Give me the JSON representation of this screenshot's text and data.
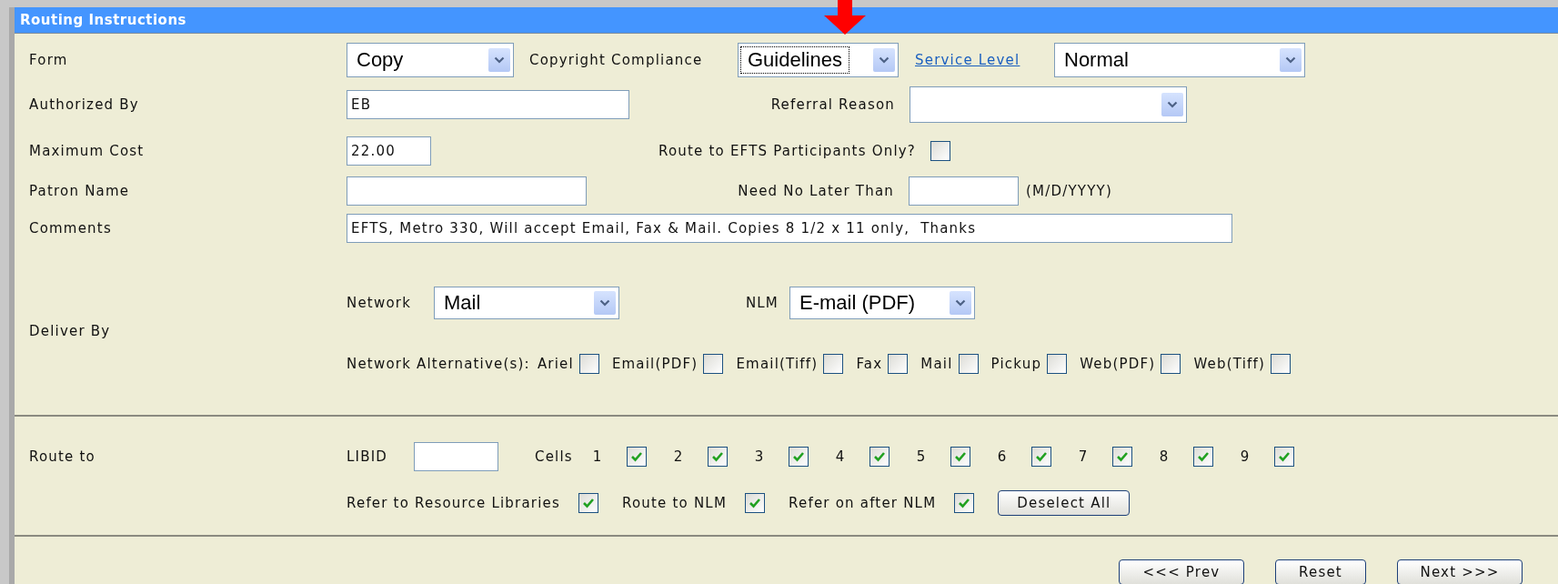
{
  "panel": {
    "title": "Routing Instructions"
  },
  "form": {
    "label": "Form",
    "value": "Copy"
  },
  "copyright_compliance": {
    "label": "Copyright Compliance",
    "value": "Guidelines",
    "focused": true
  },
  "service_level": {
    "label": "Service Level",
    "value": "Normal"
  },
  "authorized_by": {
    "label": "Authorized By",
    "value": "EB"
  },
  "referral_reason": {
    "label": "Referral Reason"
  },
  "maximum_cost": {
    "label": "Maximum Cost",
    "value": "22.00"
  },
  "route_to_efts": {
    "label": "Route to EFTS Participants Only?",
    "checked": false
  },
  "patron_name": {
    "label": "Patron Name"
  },
  "need_no_later_than": {
    "label": "Need No Later Than",
    "hint": "(M/D/YYYY)"
  },
  "comments": {
    "label": "Comments",
    "value": "EFTS, Metro 330, Will accept Email, Fax & Mail. Copies 8 1/2 x 11 only,  Thanks"
  },
  "deliver_by": {
    "label": "Deliver By",
    "network": {
      "label": "Network",
      "value": "Mail"
    },
    "nlm": {
      "label": "NLM",
      "value": "E-mail (PDF)"
    },
    "alternatives": {
      "label": "Network Alternative(s):",
      "options": [
        {
          "label": "Ariel",
          "checked": false
        },
        {
          "label": "Email(PDF)",
          "checked": false
        },
        {
          "label": "Email(Tiff)",
          "checked": false
        },
        {
          "label": "Fax",
          "checked": false
        },
        {
          "label": "Mail",
          "checked": false
        },
        {
          "label": "Pickup",
          "checked": false
        },
        {
          "label": "Web(PDF)",
          "checked": false
        },
        {
          "label": "Web(Tiff)",
          "checked": false
        }
      ]
    }
  },
  "route_to": {
    "label": "Route to",
    "libid": {
      "label": "LIBID"
    },
    "cells": {
      "label": "Cells",
      "items": [
        {
          "label": "1",
          "checked": true
        },
        {
          "label": "2",
          "checked": true
        },
        {
          "label": "3",
          "checked": true
        },
        {
          "label": "4",
          "checked": true
        },
        {
          "label": "5",
          "checked": true
        },
        {
          "label": "6",
          "checked": true
        },
        {
          "label": "7",
          "checked": true
        },
        {
          "label": "8",
          "checked": true
        },
        {
          "label": "9",
          "checked": true
        }
      ]
    },
    "options": [
      {
        "label": "Refer to Resource Libraries",
        "checked": true
      },
      {
        "label": "Route to NLM",
        "checked": true
      },
      {
        "label": "Refer on after NLM",
        "checked": true
      }
    ],
    "deselect_button": "Deselect All"
  },
  "buttons": [
    "<<< Prev",
    "Reset",
    "Next >>>"
  ]
}
